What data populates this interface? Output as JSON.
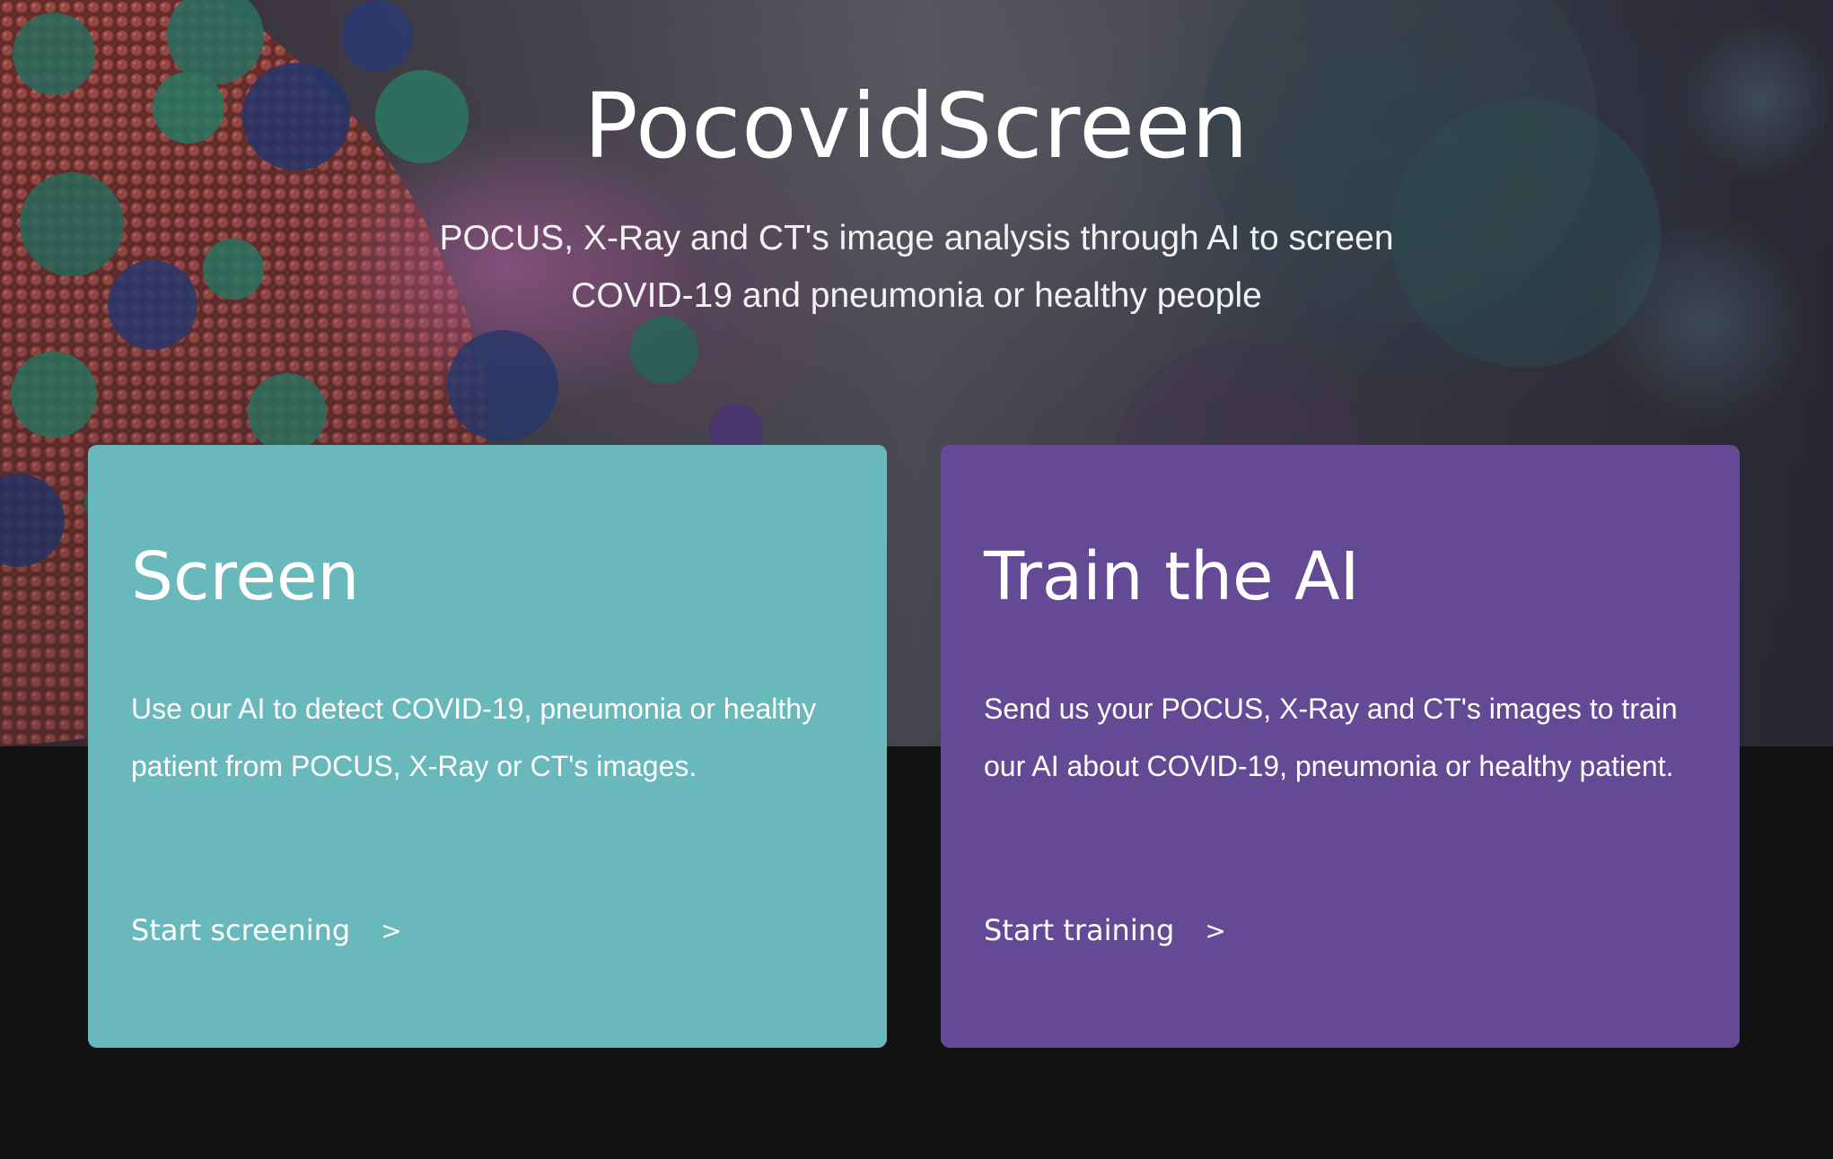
{
  "hero": {
    "title": "PocovidScreen",
    "subtitle": "POCUS, X-Ray and CT's image analysis through AI to screen COVID-19 and pneumonia or healthy people"
  },
  "cards": [
    {
      "title": "Screen",
      "description": "Use our AI to detect COVID-19, pneumonia or healthy patient from POCUS, X-Ray or CT's images.",
      "link_label": "Start screening",
      "link_icon": ">",
      "color": "#69b8bc"
    },
    {
      "title": "Train the AI",
      "description": "Send us your POCUS, X-Ray and CT's images to train our AI about COVID-19, pneumonia or healthy patient.",
      "link_label": "Start training",
      "link_icon": ">",
      "color": "#644994"
    }
  ],
  "colors": {
    "page_background": "#121212",
    "screen_card": "#69b8bc",
    "train_card": "#644994"
  }
}
